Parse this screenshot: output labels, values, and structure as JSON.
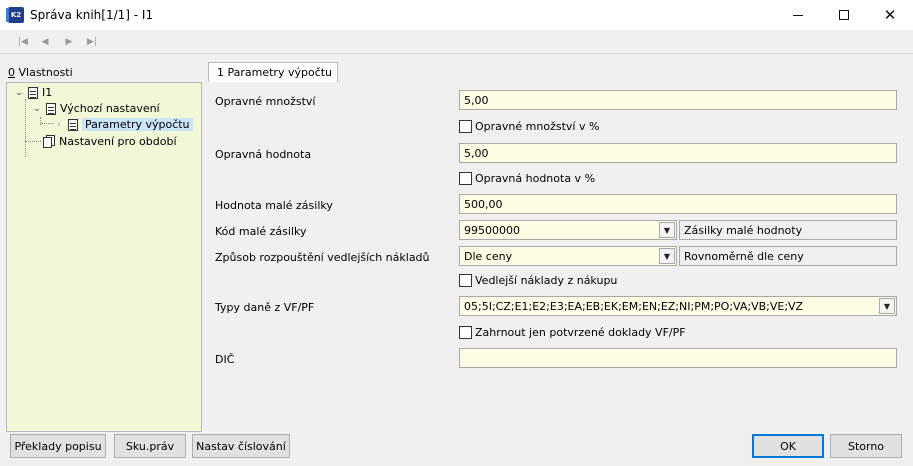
{
  "window": {
    "title": "Správa knih[1/1] - I1",
    "app_icon_text": "K2",
    "minimize": "—",
    "maximize": "☐",
    "close": "✕"
  },
  "toolbar": {
    "first": "|◀",
    "prev": "◀",
    "next": "▶",
    "last": "▶|"
  },
  "left_panel": {
    "label_key": "0",
    "label": " Vlastnosti",
    "tree": [
      {
        "label": "I1",
        "level": 0
      },
      {
        "label": "Výchozí nastavení",
        "level": 1
      },
      {
        "label": "Parametry výpočtu",
        "level": 2,
        "selected": true
      },
      {
        "label": "Nastavení pro období",
        "level": 1
      }
    ]
  },
  "tab": {
    "label": "1 Parametry výpočtu"
  },
  "form": {
    "opravne_mnozstvi": {
      "label": "Opravné množství",
      "value": "5,00"
    },
    "opravne_mnozstvi_pct": {
      "label": "Opravné množství v %"
    },
    "opravna_hodnota": {
      "label": "Opravná hodnota",
      "value": "5,00"
    },
    "opravna_hodnota_pct": {
      "label": "Opravná hodnota v %"
    },
    "hodnota_male_zasilky": {
      "label": "Hodnota malé zásilky",
      "value": "500,00"
    },
    "kod_male_zasilky": {
      "label": "Kód malé zásilky",
      "value": "99500000",
      "description": "Zásilky malé hodnoty"
    },
    "zpusob_rozpousteni": {
      "label": "Způsob rozpouštění vedlejších nákladů",
      "value": "Dle ceny",
      "description": "Rovnoměrně dle ceny"
    },
    "vedlejsi_naklady": {
      "label": "Vedlejší náklady z nákupu"
    },
    "typy_dane": {
      "label": "Typy daně z VF/PF",
      "value": "05;5I;CZ;E1;E2;E3;EA;EB;EK;EM;EN;EZ;NI;PM;PO;VA;VB;VE;VZ"
    },
    "zahrnout": {
      "label": "Zahrnout jen potvrzené doklady VF/PF"
    },
    "dic": {
      "label": "DIČ",
      "value": ""
    }
  },
  "buttons": {
    "preklady": "Překlady popisu",
    "sku_prav": "Sku.práv",
    "nastav_cislovani": "Nastav číslování",
    "ok": "OK",
    "storno": "Storno"
  }
}
